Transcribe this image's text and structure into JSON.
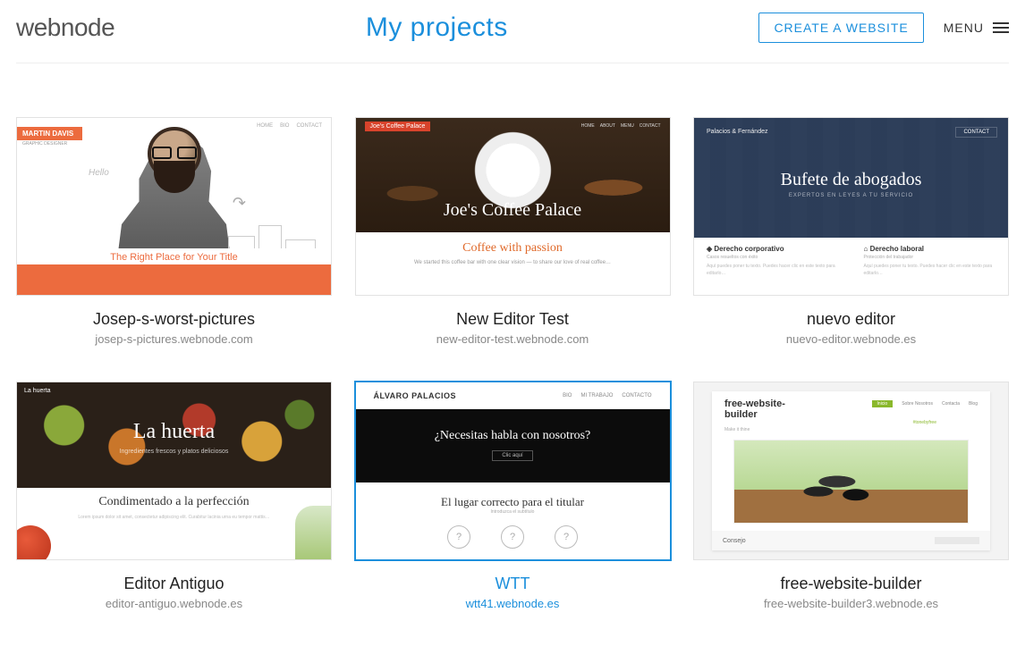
{
  "header": {
    "logo": "webnode",
    "title": "My projects",
    "create_label": "CREATE A WEBSITE",
    "menu_label": "MENU"
  },
  "projects": [
    {
      "title": "Josep-s-worst-pictures",
      "url": "josep-s-pictures.webnode.com",
      "selected": false,
      "thumb": {
        "tag": "MARTIN DAVIS",
        "subtag": "GRAPHIC DESIGNER",
        "hello": "Hello",
        "nav": [
          "HOME",
          "BIO",
          "CONTACT"
        ],
        "strap": "The Right Place for Your Title"
      }
    },
    {
      "title": "New Editor Test",
      "url": "new-editor-test.webnode.com",
      "selected": false,
      "thumb": {
        "banner": "Joe's Coffee Palace",
        "nav": [
          "HOME",
          "ABOUT",
          "MENU",
          "CONTACT"
        ],
        "hero": "Joe's Coffee Palace",
        "tagline": "Coffee with passion",
        "body": "We started this coffee bar with one clear vision — to share our love of real coffee…"
      }
    },
    {
      "title": "nuevo editor",
      "url": "nuevo-editor.webnode.es",
      "selected": false,
      "thumb": {
        "brand": "Palacios & Fernández",
        "btn": "CONTACT",
        "hero": "Bufete de abogados",
        "sub": "EXPERTOS EN LEYES A TU SERVICIO",
        "col1_title": "Derecho corporativo",
        "col1_sub": "Casos resueltos con éxito",
        "col2_title": "Derecho laboral",
        "col2_sub": "Protección del trabajador",
        "body": "Aquí puedes poner tu texto. Puedes hacer clic en este texto para editarlo…"
      }
    },
    {
      "title": "Editor Antiguo",
      "url": "editor-antiguo.webnode.es",
      "selected": false,
      "thumb": {
        "brand": "La huerta",
        "hero": "La huerta",
        "sub": "Ingredientes frescos y platos deliciosos",
        "lower_title": "Condimentado a la perfección",
        "body": "Lorem ipsum dolor sit amet, consectetur adipiscing elit. Curabitur lacinia urna eu tempor mattis…"
      }
    },
    {
      "title": "WTT",
      "url": "wtt41.webnode.es",
      "selected": true,
      "thumb": {
        "name": "ÁLVARO PALACIOS",
        "nav": [
          "BIO",
          "MI TRABAJO",
          "CONTACTO"
        ],
        "hero": "¿Necesitas habla con nosotros?",
        "cta": "Clic aquí",
        "lower_title": "El lugar correcto para el titular",
        "lower_sub": "Introduzca el subtítulo",
        "q": "?"
      }
    },
    {
      "title": "free-website-builder",
      "url": "free-website-builder3.webnode.es",
      "selected": false,
      "thumb": {
        "title": "free-website-builder",
        "sub": "Make it thine",
        "nav_on": "Inicio",
        "nav": [
          "Sobre Nosotros",
          "Contacta",
          "Blog"
        ],
        "tag": "#tonebyfree",
        "footer": "Consejo"
      }
    }
  ]
}
